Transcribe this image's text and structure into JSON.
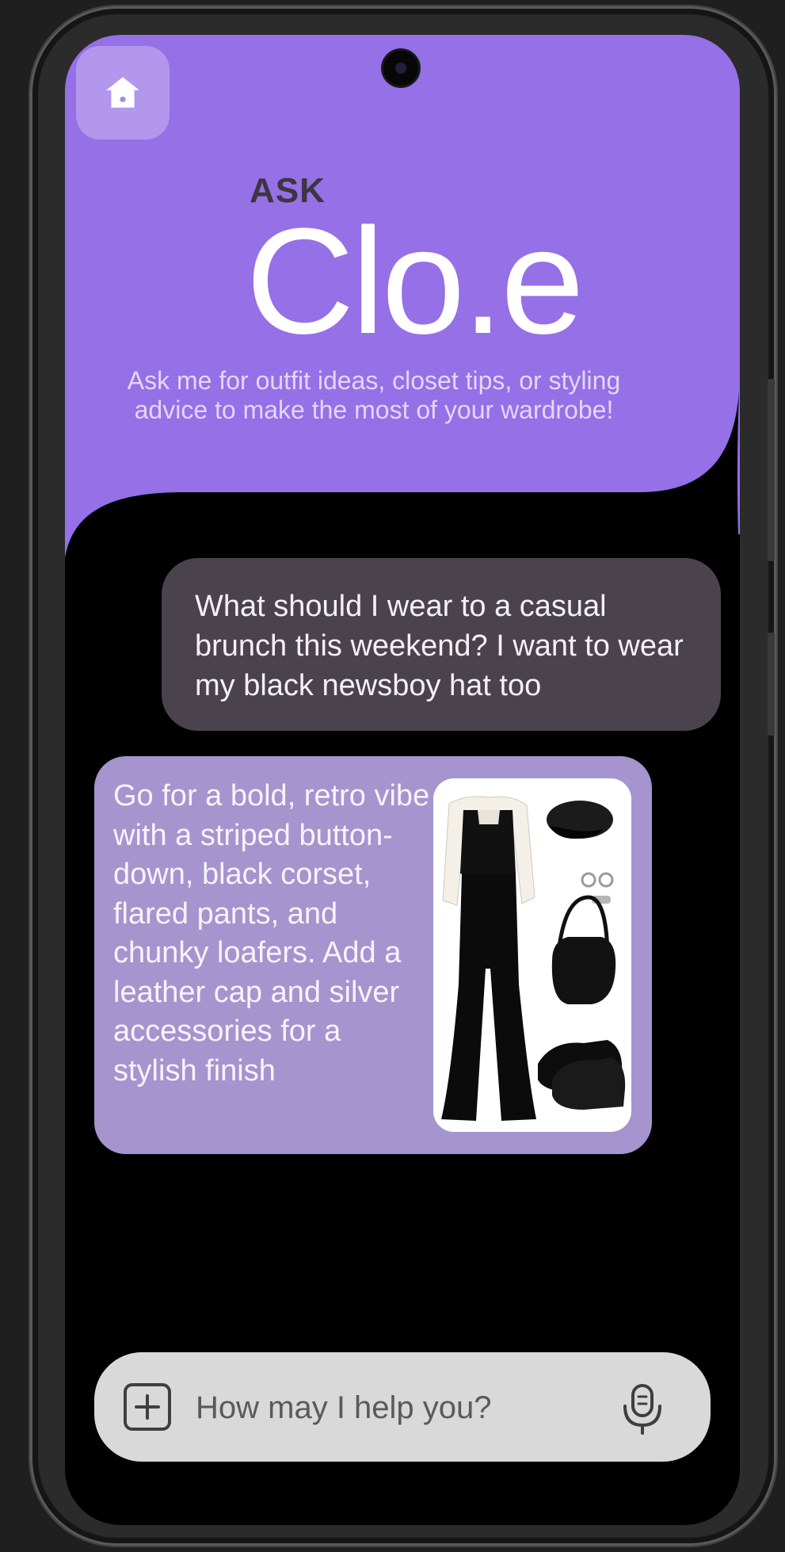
{
  "header": {
    "ask_label": "ASK",
    "app_title": "Clo.e",
    "subtitle": "Ask me for outfit ideas, closet tips, or styling advice to make the most of your wardrobe!",
    "background_color": "#9570e6"
  },
  "chat": {
    "user_message": "What should I wear to a casual brunch this weekend? I want to wear my black newsboy hat too",
    "bot_message": "Go for a bold, retro vibe with a striped button-down, black corset, flared pants, and chunky loafers. Add a leather cap and silver accessories for a stylish finish"
  },
  "composer": {
    "placeholder": "How may I help you?"
  },
  "icons": {
    "home": "home-icon",
    "add": "plus-square-icon",
    "mic": "microphone-icon"
  }
}
